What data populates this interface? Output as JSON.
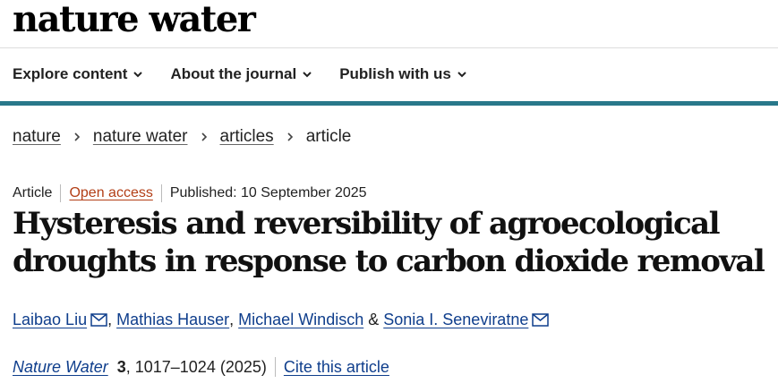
{
  "header": {
    "logo_text": "nature water"
  },
  "nav": {
    "items": [
      {
        "label": "Explore content"
      },
      {
        "label": "About the journal"
      },
      {
        "label": "Publish with us"
      }
    ]
  },
  "breadcrumb": {
    "items": [
      {
        "label": "nature"
      },
      {
        "label": "nature water"
      },
      {
        "label": "articles"
      }
    ],
    "current": "article"
  },
  "article": {
    "type": "Article",
    "access": "Open access",
    "published": "Published: 10 September 2025",
    "title": "Hysteresis and reversibility of agroecological droughts in response to carbon dioxide removal",
    "authors": [
      {
        "name": "Laibao Liu",
        "has_email": true
      },
      {
        "name": "Mathias Hauser",
        "has_email": false
      },
      {
        "name": "Michael Windisch",
        "has_email": false
      },
      {
        "name": "Sonia I. Seneviratne",
        "has_email": true
      }
    ],
    "author_separators": [
      ", ",
      ", ",
      " & "
    ],
    "citation": {
      "journal": "Nature Water",
      "volume": "3",
      "pages_year": ", 1017–1024 (2025)",
      "cite_label": "Cite this article"
    }
  },
  "colors": {
    "accent_bar": "#29788a",
    "link": "#0f3e8c",
    "open_access": "#b33f17"
  }
}
